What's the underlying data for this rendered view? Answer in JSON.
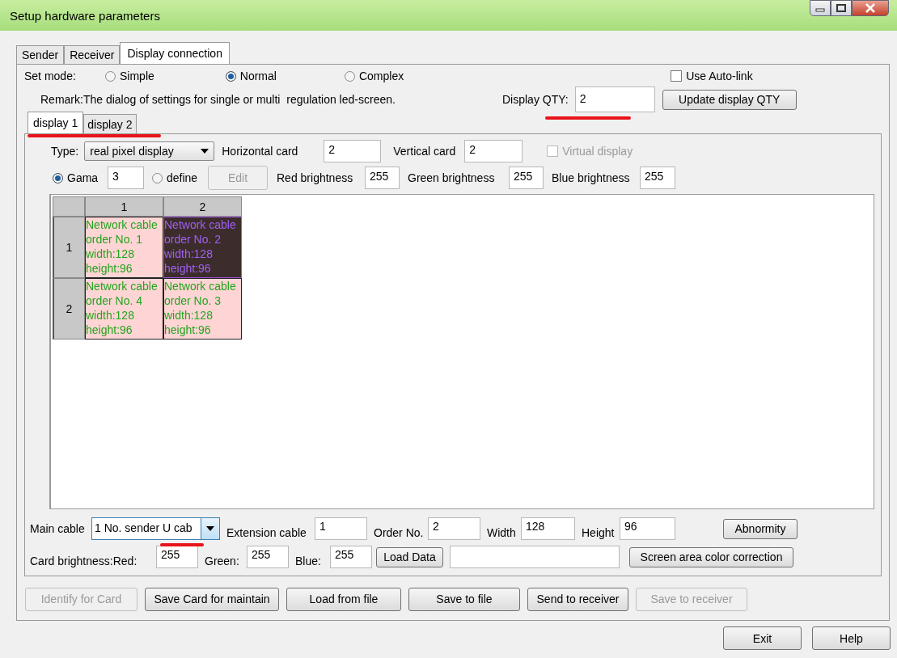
{
  "window": {
    "title": "Setup hardware parameters"
  },
  "tabs": [
    {
      "label": "Sender",
      "selected": false
    },
    {
      "label": "Receiver",
      "selected": false
    },
    {
      "label": "Display connection",
      "selected": true
    }
  ],
  "set_mode": {
    "label": "Set mode:",
    "options": [
      {
        "label": "Simple",
        "selected": false
      },
      {
        "label": "Normal",
        "selected": true
      },
      {
        "label": "Complex",
        "selected": false
      }
    ]
  },
  "auto_link": {
    "label": "Use Auto-link",
    "checked": false
  },
  "remark": "Remark:The dialog of settings for single or multi  regulation led-screen.",
  "display_qty": {
    "label": "Display QTY:",
    "value": "2"
  },
  "update_button": "Update display QTY",
  "display_tabs": [
    {
      "label": "display 1",
      "selected": true
    },
    {
      "label": "display 2",
      "selected": false
    }
  ],
  "type": {
    "label": "Type:",
    "value": "real pixel display"
  },
  "horizontal_card": {
    "label": "Horizontal card",
    "value": "2"
  },
  "vertical_card": {
    "label": "Vertical card",
    "value": "2"
  },
  "virtual_display": {
    "label": "Virtual display",
    "checked": false,
    "disabled": true
  },
  "gamma": {
    "label": "Gama",
    "selected": true,
    "value": "3"
  },
  "define": {
    "label": "define",
    "selected": false
  },
  "edit_button": {
    "label": "Edit",
    "disabled": true
  },
  "brightness": [
    {
      "label": "Red brightness",
      "value": "255"
    },
    {
      "label": "Green brightness",
      "value": "255"
    },
    {
      "label": "Blue brightness",
      "value": "255"
    }
  ],
  "grid": {
    "columns": [
      "1",
      "2"
    ],
    "rows": [
      {
        "header": "1",
        "cells": [
          {
            "lines": [
              "Network cable",
              "order No. 1",
              "width:128",
              "height:96"
            ],
            "selected": false
          },
          {
            "lines": [
              "Network cable",
              "order No. 2",
              "width:128",
              "height:96"
            ],
            "selected": true
          }
        ]
      },
      {
        "header": "2",
        "cells": [
          {
            "lines": [
              "Network cable",
              "order No. 4",
              "width:128",
              "height:96"
            ],
            "selected": false
          },
          {
            "lines": [
              "Network cable",
              "order No. 3",
              "width:128",
              "height:96"
            ],
            "selected": false
          }
        ]
      }
    ]
  },
  "main_cable": {
    "label": "Main cable",
    "value": "1 No. sender U cab"
  },
  "cable_fields": [
    {
      "label": "Extension cable",
      "value": "1"
    },
    {
      "label": "Order No.",
      "value": "2"
    },
    {
      "label": "Width",
      "value": "128"
    },
    {
      "label": "Height",
      "value": "96"
    }
  ],
  "abnormity_button": "Abnormity",
  "card_brightness": [
    {
      "label": "Card brightness:Red:",
      "value": "255"
    },
    {
      "label": "Green:",
      "value": "255"
    },
    {
      "label": "Blue:",
      "value": "255"
    }
  ],
  "load_data_button": "Load Data",
  "color_correction_button": "Screen area color correction",
  "actions": [
    {
      "label": "Identify for Card",
      "disabled": true
    },
    {
      "label": "Save Card for maintain",
      "disabled": false
    },
    {
      "label": "Load from file",
      "disabled": false
    },
    {
      "label": "Save to file",
      "disabled": false
    },
    {
      "label": "Send to receiver",
      "disabled": false
    },
    {
      "label": "Save to receiver",
      "disabled": true
    }
  ],
  "footer_buttons": [
    "Exit",
    "Help"
  ]
}
